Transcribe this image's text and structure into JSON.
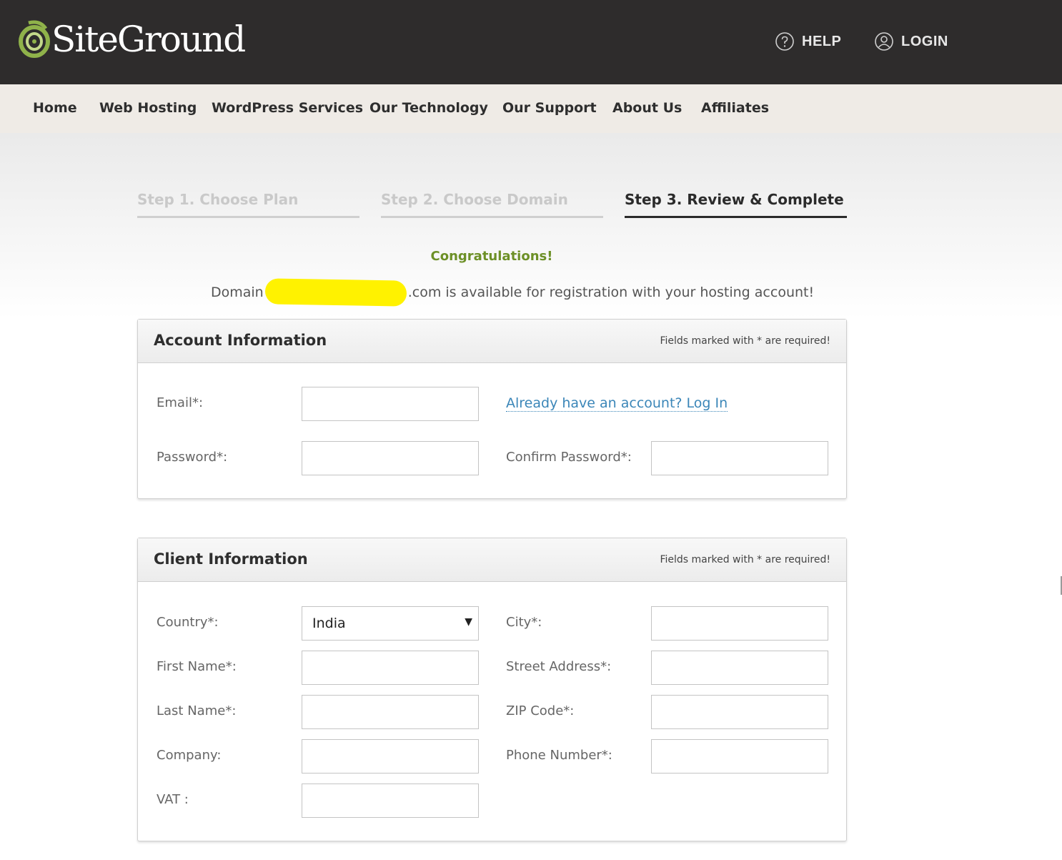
{
  "header": {
    "logo_text": "SiteGround",
    "help_label": "HELP",
    "login_label": "LOGIN"
  },
  "nav": {
    "items": [
      {
        "label": "Home"
      },
      {
        "label": "Web Hosting"
      },
      {
        "label": "WordPress Services"
      },
      {
        "label": "Our Technology"
      },
      {
        "label": "Our Support"
      },
      {
        "label": "About Us"
      },
      {
        "label": "Affiliates"
      }
    ]
  },
  "steps": [
    {
      "label": "Step 1. Choose Plan",
      "state": "done"
    },
    {
      "label": "Step 2. Choose Domain",
      "state": "done"
    },
    {
      "label": "Step 3. Review & Complete",
      "state": "active"
    }
  ],
  "message": {
    "congrats": "Congratulations!",
    "domain_prefix": "Domain",
    "domain_suffix": ".com is available for registration with your hosting account!"
  },
  "account": {
    "title": "Account Information",
    "note": "Fields marked with * are required!",
    "email_label": "Email*:",
    "password_label": "Password*:",
    "login_prompt": "Already have an account? Log In",
    "confirm_password_label": "Confirm Password*:"
  },
  "client": {
    "title": "Client Information",
    "note": "Fields marked with * are required!",
    "country_label": "Country*:",
    "country_value": "India",
    "first_name_label": "First Name*:",
    "last_name_label": "Last Name*:",
    "company_label": "Company:",
    "vat_label": "VAT :",
    "city_label": "City*:",
    "street_label": "Street Address*:",
    "zip_label": "ZIP Code*:",
    "phone_label": "Phone Number*:"
  },
  "colors": {
    "topbar": "#2e2c2c",
    "navbar": "#efebe6",
    "congrats_green": "#6d9027",
    "link_blue": "#3b86b8",
    "redaction_yellow": "#fff200"
  }
}
